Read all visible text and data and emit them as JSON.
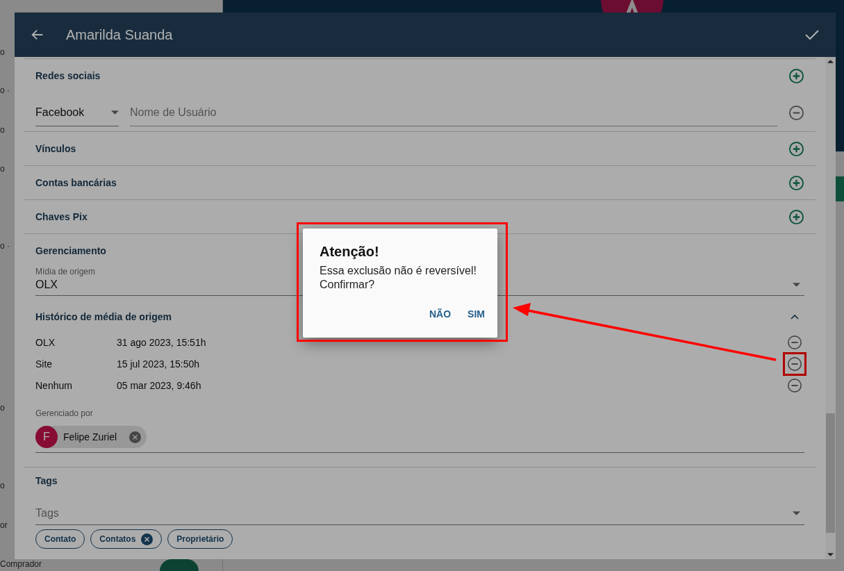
{
  "background": {
    "side_fragments": [
      {
        "text": "o"
      },
      {
        "text": "o ·"
      },
      {
        "text": "o"
      },
      {
        "text": "o"
      },
      {
        "text": "o ·"
      },
      {
        "text": "o"
      },
      {
        "text": "o"
      },
      {
        "text": "or"
      }
    ],
    "bottom_label": "Comprador"
  },
  "panel": {
    "title": "Amarilda Suanda"
  },
  "social": {
    "heading": "Redes sociais",
    "network": "Facebook",
    "username_placeholder": "Nome de Usuário"
  },
  "sections": [
    {
      "heading": "Vínculos"
    },
    {
      "heading": "Contas bancárias"
    },
    {
      "heading": "Chaves Pix"
    }
  ],
  "management": {
    "heading": "Gerenciamento",
    "origin_label": "Mídia de origem",
    "origin_value": "OLX",
    "history_heading": "Histórico de média de origem",
    "history_expanded": true,
    "history": [
      {
        "source": "OLX",
        "date": "31 ago 2023, 15:51h",
        "highlighted": false
      },
      {
        "source": "Site",
        "date": "15 jul 2023, 15:50h",
        "highlighted": true
      },
      {
        "source": "Nenhum",
        "date": "05 mar 2023, 9:46h",
        "highlighted": false
      }
    ],
    "managed_label": "Gerenciado por",
    "manager": {
      "initial": "F",
      "name": "Felipe Zuriel"
    }
  },
  "tags": {
    "heading": "Tags",
    "placeholder": "Tags",
    "chips": [
      {
        "label": "Contato",
        "removable": false
      },
      {
        "label": "Contatos",
        "removable": true
      },
      {
        "label": "Proprietário",
        "removable": false
      }
    ]
  },
  "dialog": {
    "title": "Atenção!",
    "message": "Essa exclusão não é reversível!\nConfirmar?",
    "buttons": [
      "NÃO",
      "SIM"
    ]
  }
}
